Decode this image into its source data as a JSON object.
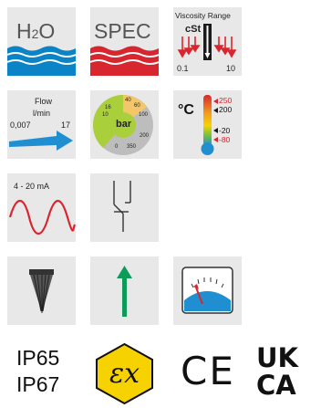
{
  "icons": {
    "h2o": {
      "label": "H2O",
      "label_main": "H",
      "label_sub": "2",
      "label_end": "O"
    },
    "spec": {
      "label": "SPEC"
    },
    "viscosity": {
      "title": "Viscosity Range",
      "unit": "cSt",
      "min": "0.1",
      "max": "10"
    },
    "flow": {
      "title": "Flow",
      "unit": "l/min",
      "min": "0,007",
      "max": "17"
    },
    "pressure": {
      "unit": "bar",
      "ticks": [
        "10",
        "16",
        "40",
        "60",
        "100",
        "200",
        "350",
        "0"
      ]
    },
    "temperature": {
      "unit": "°C",
      "v1": "250",
      "v2": "200",
      "v3": "-20",
      "v4": "-80"
    },
    "signal": {
      "label": "4 - 20 mA"
    },
    "ip": {
      "line1": "IP65",
      "line2": "IP67"
    },
    "ce": {
      "label": "CE"
    },
    "ukca": {
      "line1": "UK",
      "line2": "CA"
    }
  },
  "colors": {
    "tile_bg": "#e8e8e8",
    "water_blue": "#0a84c6",
    "spec_red": "#d8262e",
    "arrow_blue": "#1f8fd1",
    "wave_red": "#d8262e",
    "arrow_green": "#0d9b5a",
    "ex_yellow": "#f5d200",
    "gauge_green": "#a9cf3b",
    "temp_red": "#d8262e"
  }
}
